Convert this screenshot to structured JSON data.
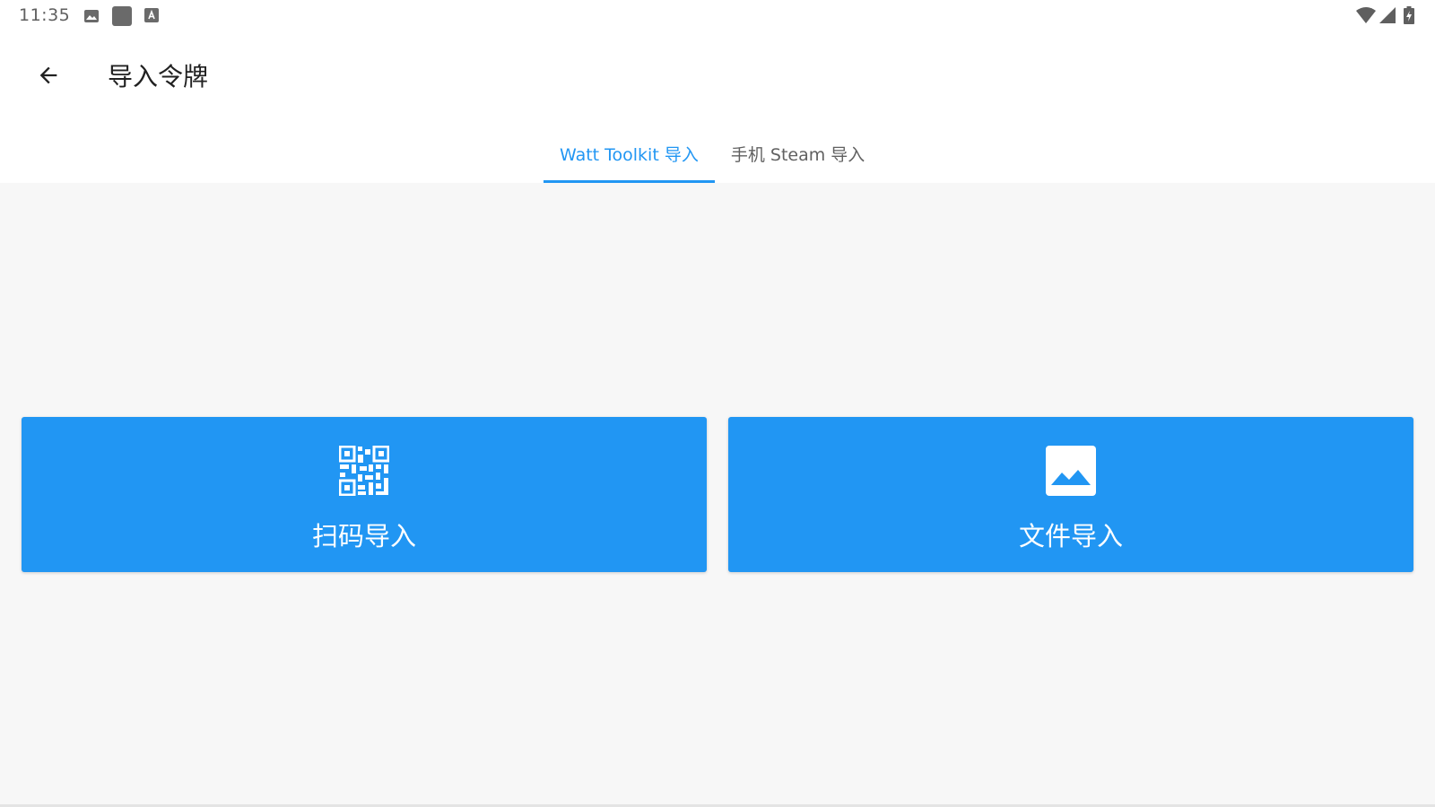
{
  "status_bar": {
    "time": "11:35",
    "left_icons": [
      "image-notification-icon",
      "app-square-icon",
      "keyboard-a-icon"
    ],
    "right_icons": [
      "wifi-icon",
      "signal-icon",
      "battery-charging-icon"
    ]
  },
  "app_bar": {
    "back_icon": "arrow-back-icon",
    "title": "导入令牌"
  },
  "tabs": [
    {
      "label": "Watt Toolkit 导入",
      "active": true
    },
    {
      "label": "手机 Steam 导入",
      "active": false
    }
  ],
  "actions": {
    "scan": {
      "icon": "qr-code-icon",
      "label": "扫码导入"
    },
    "file": {
      "icon": "image-file-icon",
      "label": "文件导入"
    }
  },
  "colors": {
    "accent": "#2196f3",
    "background": "#f7f7f7",
    "appbar": "#ffffff"
  }
}
